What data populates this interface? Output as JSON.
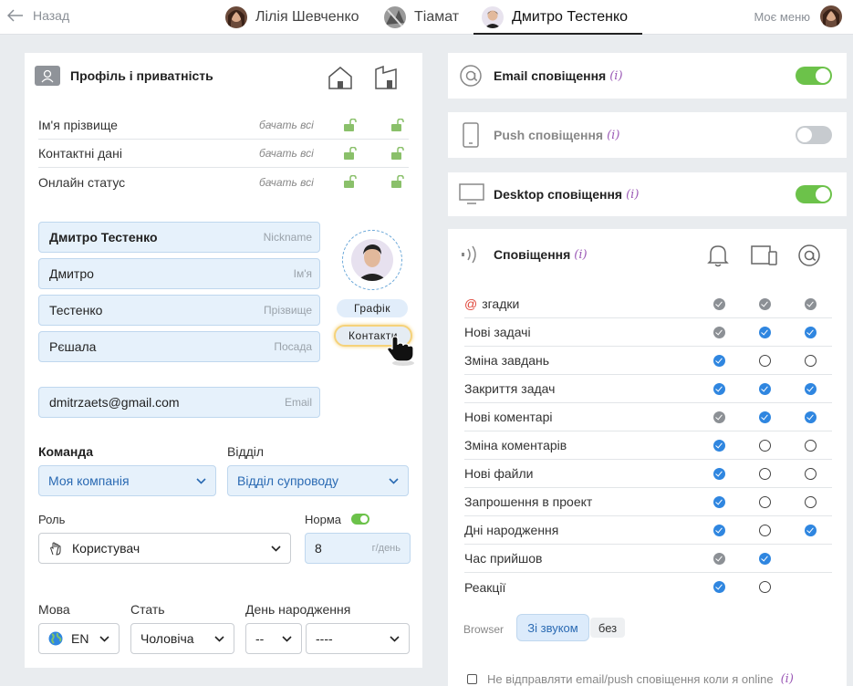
{
  "topbar": {
    "back_label": "Назад",
    "tabs": [
      {
        "name": "Лілія Шевченко"
      },
      {
        "name": "Тіамат"
      },
      {
        "name": "Дмитро Тестенко"
      }
    ],
    "my_menu": "Моє меню"
  },
  "profile": {
    "title": "Профіль і приватність",
    "privacy_rows": [
      {
        "label": "Ім'я прізвище",
        "visibility": "бачать всі"
      },
      {
        "label": "Контактні дані",
        "visibility": "бачать всі"
      },
      {
        "label": "Онлайн статус",
        "visibility": "бачать всі"
      }
    ],
    "fields": [
      {
        "value": "Дмитро Тестенко",
        "placeholder": "Nickname"
      },
      {
        "value": "Дмитро",
        "placeholder": "Ім'я"
      },
      {
        "value": "Тестенко",
        "placeholder": "Прізвище"
      },
      {
        "value": "Рєшала",
        "placeholder": "Посада"
      }
    ],
    "email": {
      "value": "dmitrzaets@gmail.com",
      "placeholder": "Email"
    },
    "schedule_label": "Графік",
    "contacts_label": "Контакти",
    "team_label": "Команда",
    "team_value": "Моя компанія",
    "dept_label": "Відділ",
    "dept_value": "Відділ супроводу",
    "role_label": "Роль",
    "role_value": "Користувач",
    "norm_label": "Норма",
    "norm_value": "8",
    "norm_unit": "г/день",
    "lang_label": "Мова",
    "lang_value": "EN",
    "gender_label": "Стать",
    "gender_value": "Чоловіча",
    "birthday_label": "День народження",
    "birthday_day": "--",
    "birthday_month": "----"
  },
  "channels": [
    {
      "title": "Email сповіщення",
      "info": "(i)",
      "on": true
    },
    {
      "title": "Push сповіщення",
      "info": "(i)",
      "on": false
    },
    {
      "title": "Desktop сповіщення",
      "info": "(i)",
      "on": true
    }
  ],
  "notifications": {
    "title": "Сповіщення",
    "info": "(i)",
    "rows": [
      {
        "at": "@",
        "label": "згадки",
        "marks": [
          "gray",
          "gray",
          "gray"
        ]
      },
      {
        "at": "",
        "label": "Нові задачі",
        "marks": [
          "gray",
          "blue",
          "blue"
        ]
      },
      {
        "at": "",
        "label": "Зміна завдань",
        "marks": [
          "blue",
          "empty",
          "empty"
        ]
      },
      {
        "at": "",
        "label": "Закриття задач",
        "marks": [
          "blue",
          "blue",
          "blue"
        ]
      },
      {
        "at": "",
        "label": "Нові коментарі",
        "marks": [
          "gray",
          "blue",
          "blue"
        ]
      },
      {
        "at": "",
        "label": "Зміна коментарів",
        "marks": [
          "blue",
          "empty",
          "empty"
        ]
      },
      {
        "at": "",
        "label": "Нові файли",
        "marks": [
          "blue",
          "empty",
          "empty"
        ]
      },
      {
        "at": "",
        "label": "Запрошення в проект",
        "marks": [
          "blue",
          "empty",
          "empty"
        ]
      },
      {
        "at": "",
        "label": "Дні народження",
        "marks": [
          "blue",
          "empty",
          "blue"
        ]
      },
      {
        "at": "",
        "label": "Час прийшов",
        "marks": [
          "gray",
          "blue",
          "none"
        ]
      },
      {
        "at": "",
        "label": "Реакції",
        "marks": [
          "blue",
          "empty",
          "none"
        ]
      }
    ],
    "browser_label": "Browser",
    "with_sound": "Зі звуком",
    "without_sound": "без",
    "online_checkbox": "Не відправляти email/push сповіщення коли я online",
    "online_info": "(i)"
  },
  "colors": {
    "accent": "#2a6ab3",
    "toggle_on": "#6cc24a",
    "field_bg": "#e6f1fb"
  }
}
